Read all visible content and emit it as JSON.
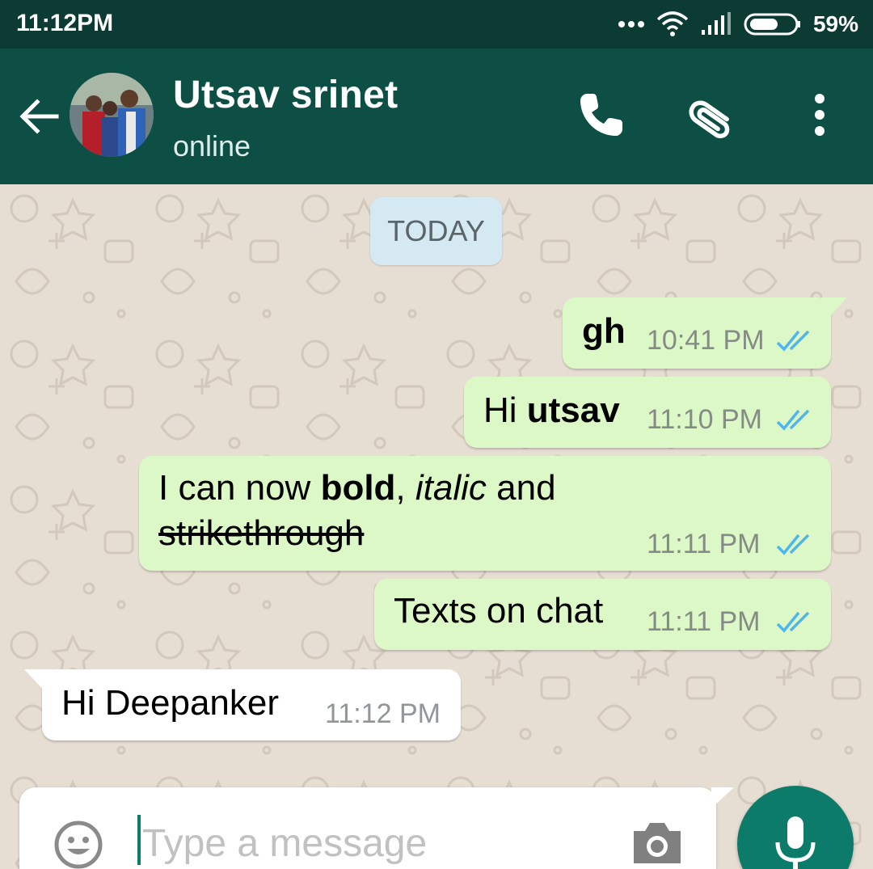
{
  "status_bar": {
    "time": "11:12PM",
    "icons": [
      "more-dots-icon",
      "wifi-icon",
      "signal-icon",
      "battery-icon"
    ],
    "battery_percent": "59%"
  },
  "header": {
    "contact_name": "Utsav srinet",
    "contact_status": "online",
    "icons": [
      "back-arrow-icon",
      "avatar",
      "phone-icon",
      "attachment-icon",
      "more-vert-icon"
    ]
  },
  "chat": {
    "date_chip": "TODAY",
    "messages": [
      {
        "direction": "outgoing",
        "text_bold": "gh",
        "time": "10:41 PM",
        "status": "read"
      },
      {
        "direction": "outgoing",
        "text": "Hi ",
        "text_bold": "utsav",
        "time": "11:10 PM",
        "status": "read"
      },
      {
        "direction": "outgoing",
        "text_part1": "I can now ",
        "text_bold": "bold",
        "text_part2": ", ",
        "text_italic": "italic",
        "text_part3": " and",
        "text_strike": "strikethrough",
        "time": "11:11 PM",
        "status": "read"
      },
      {
        "direction": "outgoing",
        "text": "Texts on chat",
        "time": "11:11 PM",
        "status": "read"
      },
      {
        "direction": "incoming",
        "text": "Hi Deepanker",
        "time": "11:12 PM"
      }
    ]
  },
  "composer": {
    "placeholder": "Type a message",
    "value": "",
    "icons": [
      "emoji-icon",
      "camera-icon",
      "mic-icon"
    ]
  },
  "colors": {
    "status_bar": "#0b3b33",
    "header": "#0d4f45",
    "outgoing_bubble": "#dcf8c6",
    "incoming_bubble": "#ffffff",
    "date_chip": "#d5e9f3",
    "read_tick": "#4fb6ec",
    "mic_button": "#0d7b69",
    "wallpaper": "#e6ddd3"
  }
}
